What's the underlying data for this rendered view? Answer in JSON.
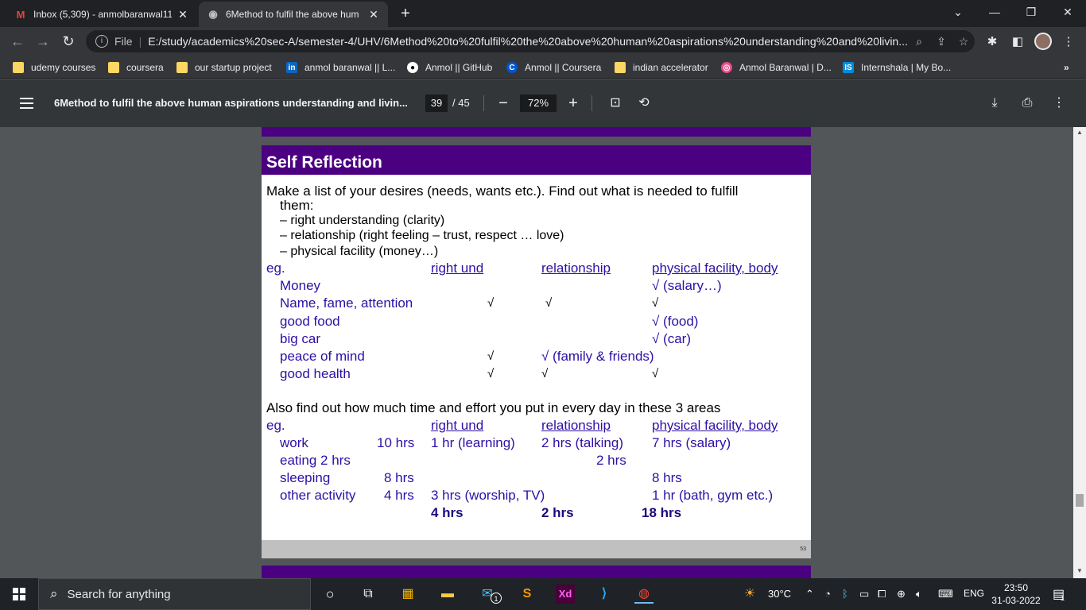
{
  "tabs": [
    {
      "title": "Inbox (5,309) - anmolbaranwal11",
      "icon": "gmail-icon",
      "active": false
    },
    {
      "title": "6Method to fulfil the above hum",
      "icon": "globe-icon",
      "active": true
    }
  ],
  "address_bar": {
    "scheme_label": "File",
    "url": "E:/study/academics%20sec-A/semester-4/UHV/6Method%20to%20fulfil%20the%20above%20human%20aspirations%20understanding%20and%20livin..."
  },
  "bookmarks": [
    {
      "label": "udemy courses",
      "icon": "folder-icon"
    },
    {
      "label": "coursera",
      "icon": "folder-icon"
    },
    {
      "label": "our startup project",
      "icon": "folder-icon"
    },
    {
      "label": "anmol baranwal || L...",
      "icon": "linkedin-icon"
    },
    {
      "label": "Anmol || GitHub",
      "icon": "github-icon"
    },
    {
      "label": "Anmol || Coursera",
      "icon": "coursera-icon"
    },
    {
      "label": "indian accelerator",
      "icon": "folder-icon"
    },
    {
      "label": "Anmol Baranwal | D...",
      "icon": "dribbble-icon"
    },
    {
      "label": "Internshala | My Bo...",
      "icon": "internshala-icon"
    }
  ],
  "bookmarks_overflow": "»",
  "pdf_toolbar": {
    "title": "6Method to fulfil the above human aspirations understanding and livin...",
    "page_current": "39",
    "page_total": "/ 45",
    "zoom": "72%"
  },
  "slide": {
    "heading": "Self Reflection",
    "intro_line1": "Make a list of your desires (needs, wants etc.). Find out what is needed to fulfill",
    "intro_line2": "them:",
    "needs": [
      "– right understanding (clarity)",
      "– relationship (right feeling – trust, respect … love)",
      "– physical facility (money…)"
    ],
    "eg": "eg.",
    "col_right_und": "right und",
    "col_relationship": "relationship",
    "col_physical": "physical facility, body",
    "check": "√",
    "desires": [
      {
        "name": "Money",
        "ru": "",
        "rel": "",
        "phys": "√ (salary…)"
      },
      {
        "name": "Name, fame, attention",
        "ru": "√",
        "rel": "√",
        "phys": "√"
      },
      {
        "name": "good food",
        "ru": "",
        "rel": "",
        "phys": "√ (food)"
      },
      {
        "name": "big car",
        "ru": "",
        "rel": "",
        "phys": "√ (car)"
      },
      {
        "name": "peace of mind",
        "ru": "√",
        "rel": "√ (family & friends)",
        "phys": ""
      },
      {
        "name": "good health",
        "ru": "√",
        "rel": "√",
        "phys": "√"
      }
    ],
    "time_intro": "Also find out how much time and effort you put in every day in these 3 areas",
    "time_rows": [
      {
        "name": "work",
        "hrs": "10 hrs",
        "ru": "1 hr (learning)",
        "rel": "2 hrs (talking)",
        "phys": "7 hrs (salary)"
      },
      {
        "name": "eating  2 hrs",
        "hrs": "",
        "ru": "",
        "rel": "2 hrs",
        "phys": ""
      },
      {
        "name": "sleeping",
        "hrs": "8 hrs",
        "ru": "",
        "rel": "",
        "phys": "8 hrs"
      },
      {
        "name": "other activity",
        "hrs": "4 hrs",
        "ru": "3 hrs (worship, TV)",
        "rel": "",
        "phys": "1 hr (bath, gym etc.)"
      }
    ],
    "totals": {
      "ru": "4 hrs",
      "rel": "2 hrs",
      "phys": "18 hrs"
    },
    "page_number": "53"
  },
  "taskbar": {
    "search_placeholder": "Search for anything",
    "weather": "30°C",
    "language": "ENG",
    "time": "23:50",
    "date": "31-03-2022",
    "mail_badge": "1",
    "notification_badge": "1"
  }
}
